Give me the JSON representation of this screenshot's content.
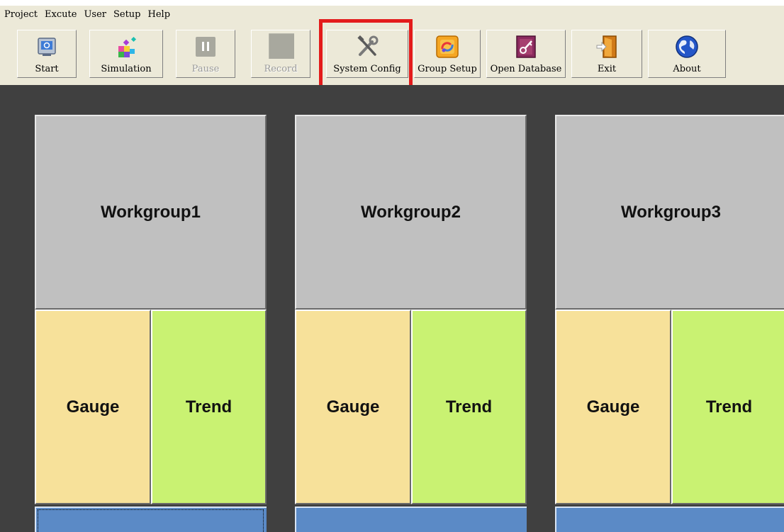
{
  "menu": {
    "items": [
      "Project",
      "Excute",
      "User",
      "Setup",
      "Help"
    ]
  },
  "toolbar": {
    "buttons": [
      {
        "label": "Start",
        "icon": "monitor-icon",
        "disabled": false
      },
      {
        "label": "Simulation",
        "icon": "cubes-icon",
        "disabled": false
      },
      {
        "label": "Pause",
        "icon": "pause-icon",
        "disabled": true
      },
      {
        "label": "Record",
        "icon": "record-icon",
        "disabled": true
      },
      {
        "label": "System Config",
        "icon": "tools-icon",
        "disabled": false
      },
      {
        "label": "Group Setup",
        "icon": "group-setup-icon",
        "disabled": false
      },
      {
        "label": "Open Database",
        "icon": "database-key-icon",
        "disabled": false
      },
      {
        "label": "Exit",
        "icon": "door-exit-icon",
        "disabled": false
      },
      {
        "label": "About",
        "icon": "globe-icon",
        "disabled": false
      }
    ],
    "highlighted": "System Config"
  },
  "workgroups": [
    {
      "title": "Workgroup1",
      "gauge_label": "Gauge",
      "trend_label": "Trend"
    },
    {
      "title": "Workgroup2",
      "gauge_label": "Gauge",
      "trend_label": "Trend"
    },
    {
      "title": "Workgroup3",
      "gauge_label": "Gauge",
      "trend_label": "Trend"
    }
  ],
  "colors": {
    "workspace_bg": "#404040",
    "title_tile": "#c0c0c0",
    "gauge_tile": "#f7e19a",
    "trend_tile": "#c9f272",
    "bottom_bar": "#5b8ac6",
    "highlight": "#e31b1b"
  }
}
